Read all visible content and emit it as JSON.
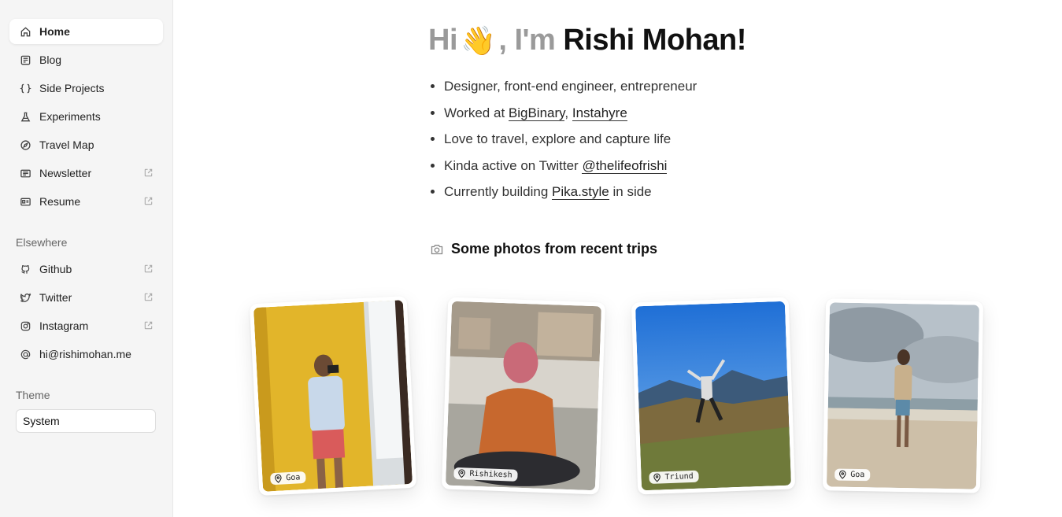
{
  "sidebar": {
    "nav": [
      {
        "label": "Home",
        "icon": "home-icon",
        "external": false,
        "active": true
      },
      {
        "label": "Blog",
        "icon": "blog-icon",
        "external": false,
        "active": false
      },
      {
        "label": "Side Projects",
        "icon": "braces-icon",
        "external": false,
        "active": false
      },
      {
        "label": "Experiments",
        "icon": "flask-icon",
        "external": false,
        "active": false
      },
      {
        "label": "Travel Map",
        "icon": "compass-icon",
        "external": false,
        "active": false
      },
      {
        "label": "Newsletter",
        "icon": "newsletter-icon",
        "external": true,
        "active": false
      },
      {
        "label": "Resume",
        "icon": "id-card-icon",
        "external": true,
        "active": false
      }
    ],
    "elsewhere_label": "Elsewhere",
    "elsewhere": [
      {
        "label": "Github",
        "icon": "github-icon",
        "external": true
      },
      {
        "label": "Twitter",
        "icon": "twitter-icon",
        "external": true
      },
      {
        "label": "Instagram",
        "icon": "instagram-icon",
        "external": true
      },
      {
        "label": "hi@rishimohan.me",
        "icon": "at-icon",
        "external": false
      }
    ],
    "theme_label": "Theme",
    "theme_value": "System"
  },
  "hero": {
    "hi": "Hi",
    "wave": "👋",
    "im": ", I'm",
    "name": "Rishi Mohan!"
  },
  "bullets": {
    "b1": "Designer, front-end engineer, entrepreneur",
    "b2_prefix": "Worked at ",
    "b2_link1": "BigBinary",
    "b2_sep": ", ",
    "b2_link2": "Instahyre",
    "b3": "Love to travel, explore and capture life",
    "b4_prefix": "Kinda active on Twitter ",
    "b4_link": "@thelifeofrishi",
    "b5_prefix": "Currently building ",
    "b5_link": "Pika.style",
    "b5_suffix": " in side"
  },
  "photos": {
    "heading": "Some photos from recent trips",
    "items": [
      {
        "location": "Goa"
      },
      {
        "location": "Rishikesh"
      },
      {
        "location": "Triund"
      },
      {
        "location": "Goa"
      }
    ]
  },
  "colors": {
    "sidebar_bg": "#f5f5f5",
    "muted_text": "#9a9a9a",
    "text": "#111111"
  }
}
